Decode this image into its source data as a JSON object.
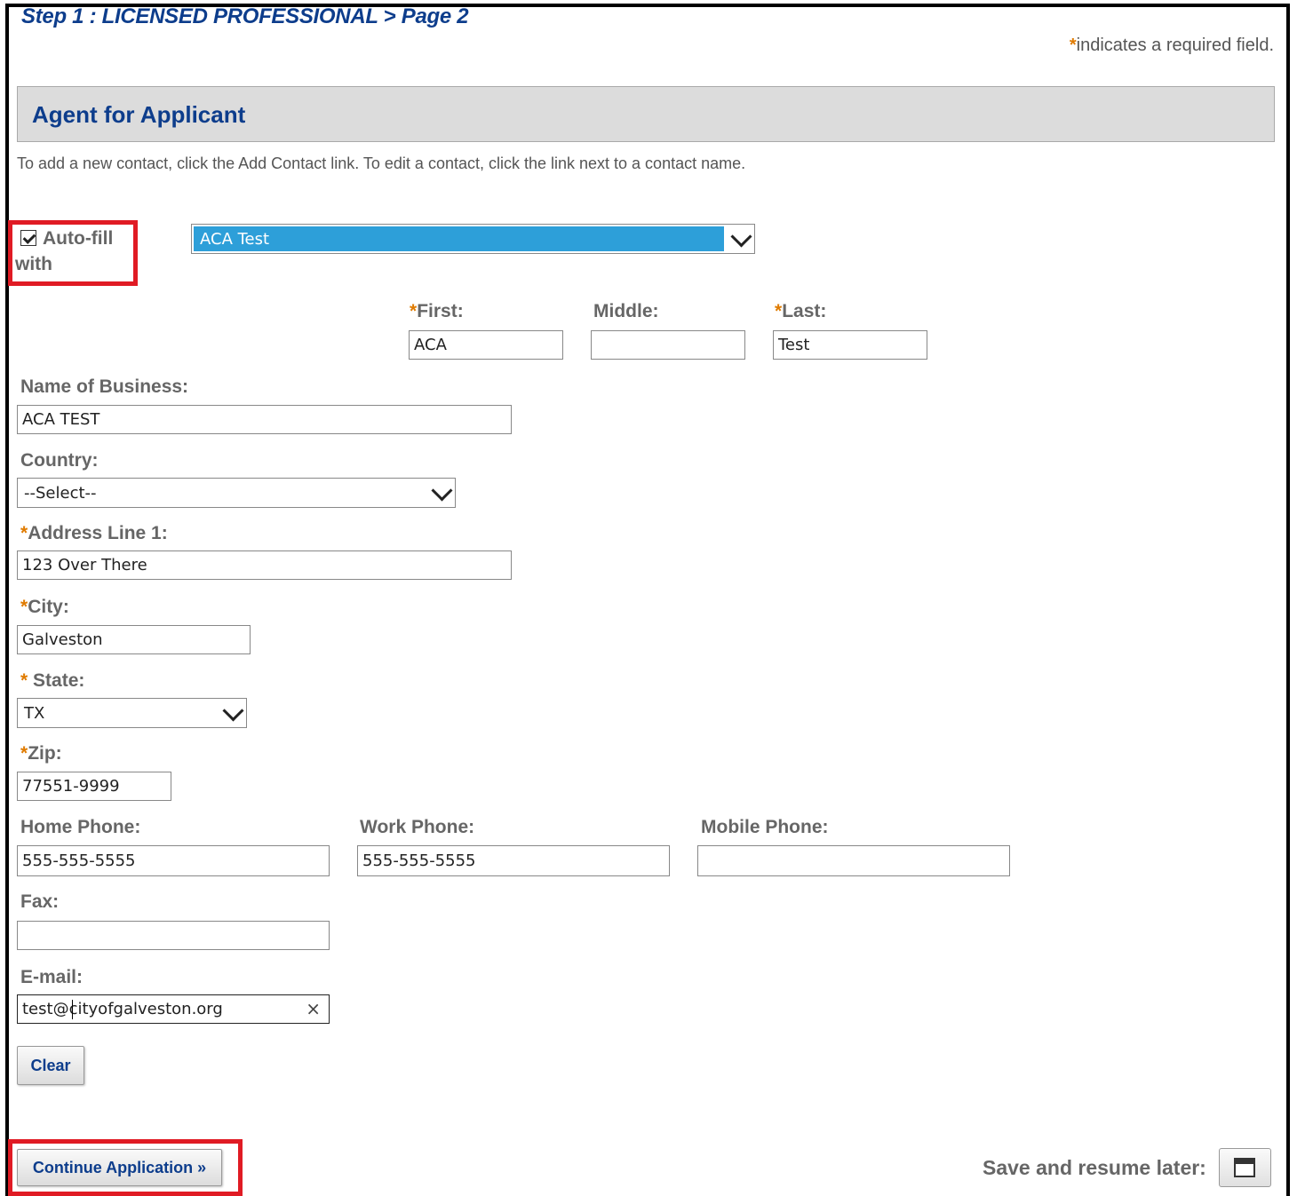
{
  "header": {
    "step_title": "Step 1 : LICENSED PROFESSIONAL > Page 2",
    "required_star": "*",
    "required_note": "indicates a required field."
  },
  "section": {
    "title": "Agent for Applicant",
    "help_text": "To add a new contact, click the Add Contact link. To edit a contact, click the link next to a contact name."
  },
  "autofill": {
    "checked": true,
    "label_line1": "Auto-fill",
    "label_line2": "with",
    "selected_value": "ACA Test",
    "highlight_color": "#2d9fd9"
  },
  "fields": {
    "first": {
      "label": "First:",
      "required": true,
      "value": "ACA"
    },
    "middle": {
      "label": "Middle:",
      "required": false,
      "value": ""
    },
    "last": {
      "label": "Last:",
      "required": true,
      "value": "Test"
    },
    "business": {
      "label": "Name of Business:",
      "required": false,
      "value": "ACA TEST"
    },
    "country": {
      "label": "Country:",
      "required": false,
      "value": "--Select--"
    },
    "address1": {
      "label": "Address Line 1:",
      "required": true,
      "value": "123 Over There"
    },
    "city": {
      "label": "City:",
      "required": true,
      "value": "Galveston"
    },
    "state": {
      "label": "State:",
      "required": true,
      "value": "TX"
    },
    "zip": {
      "label": "Zip:",
      "required": true,
      "value": "77551-9999"
    },
    "home_phone": {
      "label": "Home Phone:",
      "required": false,
      "value": "555-555-5555"
    },
    "work_phone": {
      "label": "Work Phone:",
      "required": false,
      "value": "555-555-5555"
    },
    "mobile_phone": {
      "label": "Mobile Phone:",
      "required": false,
      "value": ""
    },
    "fax": {
      "label": "Fax:",
      "required": false,
      "value": ""
    },
    "email": {
      "label": "E-mail:",
      "required": false,
      "value_before_caret": "test",
      "value_after_caret": "@cityofgalveston.org",
      "clear_glyph": "×"
    }
  },
  "buttons": {
    "clear": "Clear",
    "continue": "Continue Application »",
    "save_label": "Save and resume later:",
    "save_icon": "floppy-disk-icon"
  },
  "colors": {
    "title_blue": "#0d3d8c",
    "required_star": "#e07b00",
    "annotation_red": "#e01b24",
    "header_gray": "#dcdcdc"
  }
}
